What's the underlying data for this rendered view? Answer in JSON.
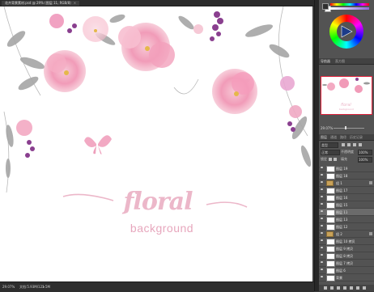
{
  "document": {
    "tab_title": "花卉背景素材.psd @ 29% (图层 11, RGB/8)",
    "close_symbol": "×"
  },
  "canvas": {
    "title": "floral",
    "subtitle": "background",
    "colors": {
      "title": "#ecb7c9",
      "subtitle": "#e7a7bd",
      "flower_pink": "#f2a4bf",
      "leaf_gray": "#8c8c8c",
      "berry_purple": "#8a3f8f"
    }
  },
  "status": {
    "zoom": "29.07%",
    "doc_info": "文档:5.93M/121.5M",
    "arrow": ">"
  },
  "panels": {
    "color": {
      "foreground": "#2f2f2f",
      "background": "#ffffff"
    },
    "navigator": {
      "tab1": "导航器",
      "tab2": "直方图",
      "zoom": "29.07%"
    },
    "layers": {
      "tabs": [
        "图层",
        "通道",
        "路径",
        "历史记录"
      ],
      "kind_label": "类型",
      "blend_mode": "正常",
      "opacity_label": "不透明度",
      "opacity_value": "100%",
      "lock_label": "锁定",
      "fill_label": "填充",
      "fill_value": "100%",
      "items": [
        {
          "name": "图层 19",
          "type": "layer"
        },
        {
          "name": "图层 18",
          "type": "layer"
        },
        {
          "name": "组 1",
          "type": "group"
        },
        {
          "name": "图层 17",
          "type": "layer"
        },
        {
          "name": "图层 16",
          "type": "layer"
        },
        {
          "name": "图层 15",
          "type": "layer"
        },
        {
          "name": "图层 11",
          "type": "layer"
        },
        {
          "name": "图层 13",
          "type": "layer"
        },
        {
          "name": "图层 12",
          "type": "layer"
        },
        {
          "name": "组 2",
          "type": "group"
        },
        {
          "name": "图层 10 拷贝",
          "type": "layer"
        },
        {
          "name": "图层 9 拷贝",
          "type": "layer"
        },
        {
          "name": "图层 8 拷贝",
          "type": "layer"
        },
        {
          "name": "图层 7 拷贝",
          "type": "layer"
        },
        {
          "name": "图层 6",
          "type": "layer"
        },
        {
          "name": "背景",
          "type": "layer"
        }
      ]
    }
  }
}
